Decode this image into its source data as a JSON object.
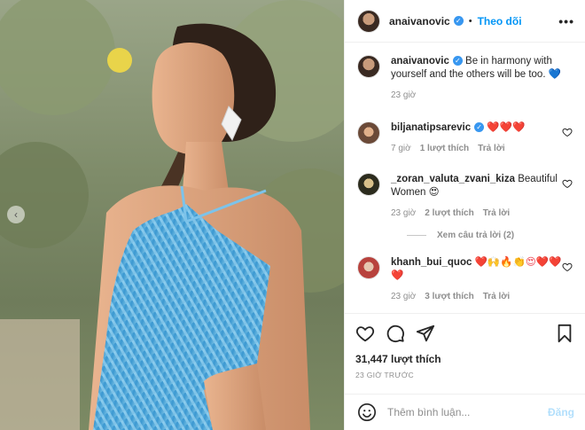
{
  "header": {
    "username": "anaivanovic",
    "separator": "•",
    "follow_label": "Theo dõi",
    "more_label": "•••"
  },
  "caption": {
    "username": "anaivanovic",
    "text": "Be in harmony with yourself and the others will be too.",
    "emoji": "💙",
    "time": "23 giờ"
  },
  "comments": [
    {
      "username": "biljanatipsarevic",
      "verified": true,
      "text": "❤️❤️❤️",
      "time": "7 giờ",
      "likes": "1 lượt thích",
      "reply": "Trả lời"
    },
    {
      "username": "_zoran_valuta_zvani_kiza",
      "verified": false,
      "text": "Beautiful Women 😍",
      "time": "23 giờ",
      "likes": "2 lượt thích",
      "reply": "Trả lời",
      "view_replies": "Xem câu trả lời (2)"
    },
    {
      "username": "khanh_bui_quoc",
      "verified": false,
      "text": "❤️🙌🔥👏😍❤️❤️❤️",
      "time": "23 giờ",
      "likes": "3 lượt thích",
      "reply": "Trả lời"
    }
  ],
  "actions": {
    "like_count": "31,447 lượt thích",
    "timestamp": "23 GIỜ TRƯỚC"
  },
  "add_comment": {
    "placeholder": "Thêm bình luận...",
    "post_label": "Đăng"
  },
  "icons": [
    "chevron-left-icon",
    "verified-icon",
    "more-icon",
    "heart-icon",
    "comment-icon",
    "share-icon",
    "bookmark-icon",
    "emoji-icon"
  ],
  "colors": {
    "link_blue": "#0095f6",
    "verified_blue": "#3897f0",
    "muted": "#8e8e8e",
    "post_disabled": "#b2dffc",
    "dress_blue": "#4aa6d8"
  }
}
